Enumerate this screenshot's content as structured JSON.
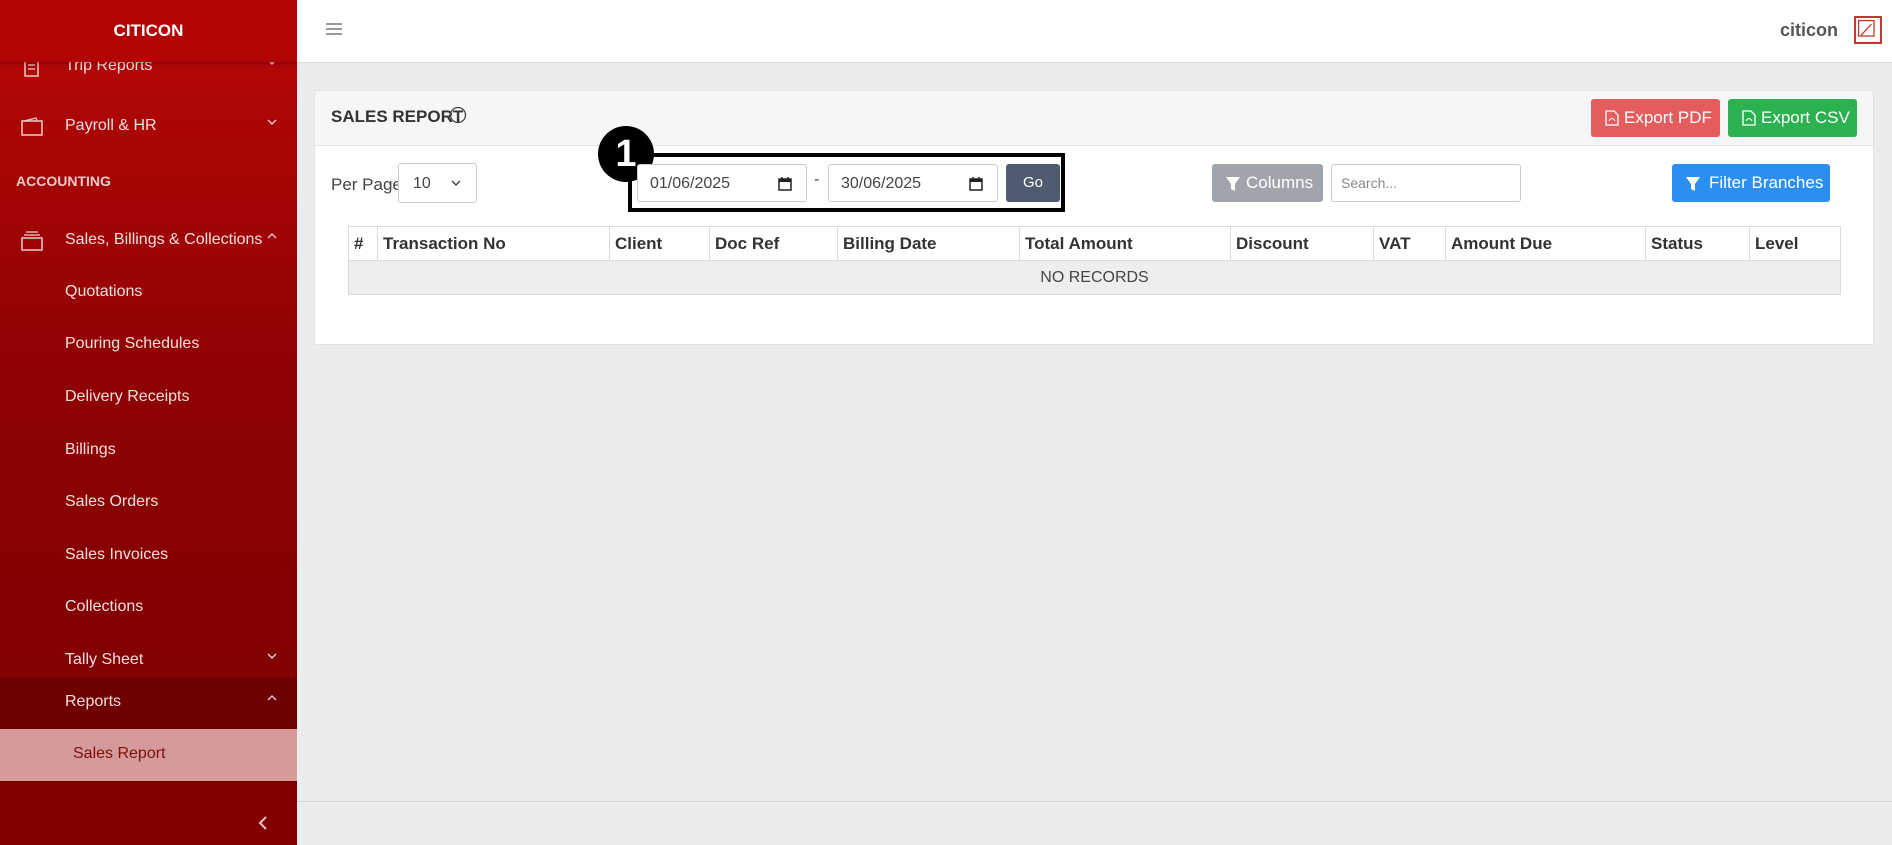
{
  "brand": "CITICON",
  "sidebar": {
    "items_top": [
      {
        "label": "Trip Reports"
      },
      {
        "label": "Payroll & HR"
      }
    ],
    "section_heading": "ACCOUNTING",
    "group": {
      "label": "Sales, Billings & Collections"
    },
    "sub_items": [
      {
        "label": "Quotations"
      },
      {
        "label": "Pouring Schedules"
      },
      {
        "label": "Delivery Receipts"
      },
      {
        "label": "Billings"
      },
      {
        "label": "Sales Orders"
      },
      {
        "label": "Sales Invoices"
      },
      {
        "label": "Collections"
      },
      {
        "label": "Tally Sheet"
      },
      {
        "label": "Reports"
      }
    ],
    "active_item": {
      "label": "Sales Report"
    }
  },
  "topbar": {
    "username": "citicon"
  },
  "card": {
    "title": "SALES REPORT",
    "export_pdf_label": "Export PDF",
    "export_csv_label": "Export CSV",
    "per_page_label": "Per Page",
    "per_page_value": "10",
    "date_from": "01/06/2025",
    "date_separator": "-",
    "date_to": "30/06/2025",
    "go_label": "Go",
    "step_badge": "1",
    "columns_label": "Columns",
    "search_placeholder": "Search...",
    "filter_branches_label": "Filter Branches"
  },
  "table": {
    "headers": [
      "#",
      "Transaction No",
      "Client",
      "Doc Ref",
      "Billing Date",
      "Total Amount",
      "Discount",
      "VAT",
      "Amount Due",
      "Status",
      "Level"
    ],
    "empty_message": "NO RECORDS"
  },
  "colors": {
    "sidebar": "#8f0202",
    "export_pdf": "#e35d5d",
    "export_csv": "#2bb14f",
    "filter": "#2b8ff2",
    "go": "#4f5b6e"
  }
}
